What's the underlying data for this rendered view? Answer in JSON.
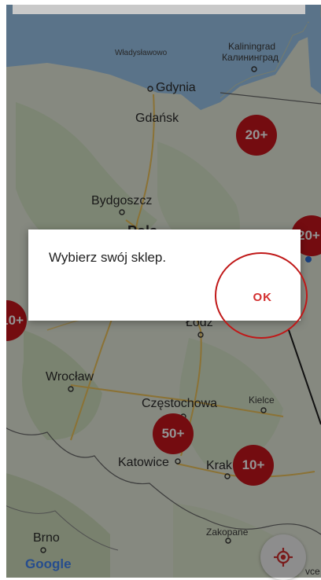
{
  "map": {
    "cities": {
      "wladyslawowo": "Władysławowo",
      "kaliningrad": "Kaliningrad",
      "kaliningrad_ru": "Калининград",
      "gdynia": "Gdynia",
      "gdansk": "Gdańsk",
      "bydgoszcz": "Bydgoszcz",
      "lodz": "Łódź",
      "wroclaw": "Wrocław",
      "czestochowa": "Częstochowa",
      "kielce": "Kielce",
      "katowice": "Katowice",
      "krakow": "Krak",
      "brno": "Brno",
      "zakopane": "Zakopane",
      "poland_partial": "Pols",
      "partial_vce": "vce"
    },
    "clusters": {
      "gdansk_area": "20+",
      "east": "20+",
      "west": "10+",
      "czestochowa_area": "50+",
      "krakow_area": "10+"
    },
    "attribution": "Google"
  },
  "dialog": {
    "message": "Wybierz swój sklep.",
    "ok_label": "OK"
  },
  "colors": {
    "accent": "#d32f2f",
    "cluster": "#c8161d"
  },
  "icons": {
    "location": "my-location-icon"
  }
}
